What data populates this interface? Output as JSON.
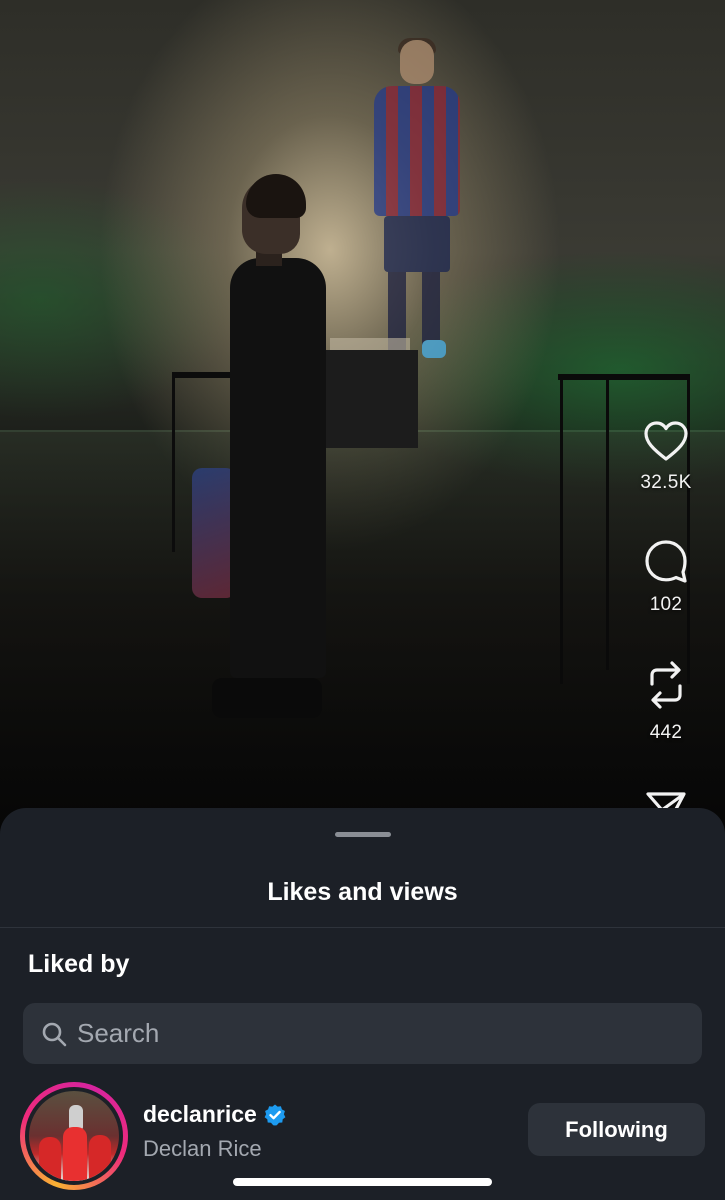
{
  "reel": {
    "actions": {
      "likes": "32.5K",
      "comments": "102",
      "reposts": "442"
    }
  },
  "sheet": {
    "title": "Likes and views",
    "section_label": "Liked by",
    "search": {
      "placeholder": "Search",
      "value": ""
    },
    "users": [
      {
        "username": "declanrice",
        "full_name": "Declan Rice",
        "verified": true,
        "action_label": "Following"
      }
    ]
  },
  "colors": {
    "sheet_background": "#1c2027",
    "input_background": "#2d323a",
    "secondary_text": "#a3a8b0",
    "verified_badge": "#1d9bf0"
  }
}
